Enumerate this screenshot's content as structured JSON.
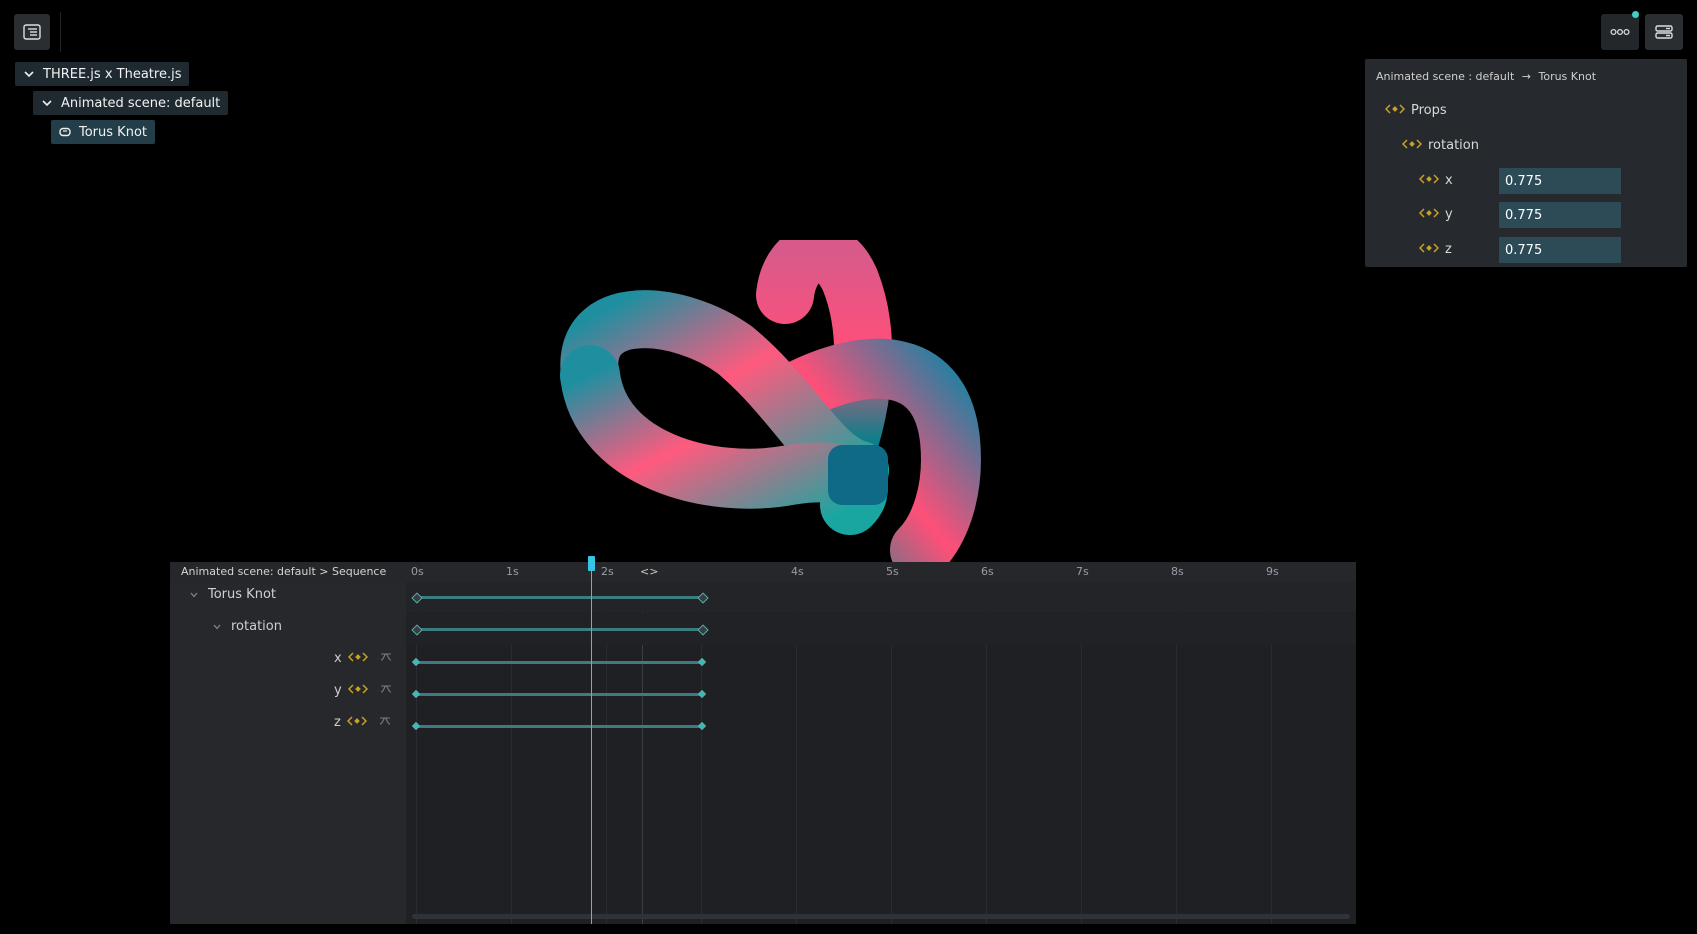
{
  "outline": {
    "items": [
      {
        "label": "THREE.js x Theatre.js"
      },
      {
        "label": "Animated scene: default"
      },
      {
        "label": "Torus Knot"
      }
    ]
  },
  "details": {
    "breadcrumb_sheet": "Animated scene : default",
    "breadcrumb_arrow": "→",
    "breadcrumb_object": "Torus Knot",
    "props_label": "Props",
    "rotation_label": "rotation",
    "fields": [
      {
        "label": "x",
        "value": "0.775"
      },
      {
        "label": "y",
        "value": "0.775"
      },
      {
        "label": "z",
        "value": "0.775"
      }
    ]
  },
  "sequence": {
    "breadcrumb": "Animated scene: default > Sequence",
    "ticks": [
      "0s",
      "1s",
      "2s",
      "4s",
      "5s",
      "6s",
      "7s",
      "8s",
      "9s"
    ],
    "range_end_icon": "<>",
    "rows": {
      "object": "Torus Knot",
      "prop": "rotation",
      "x": "x",
      "y": "y",
      "z": "z"
    },
    "playhead_position_s": 1.9,
    "range_end_s": 3
  },
  "colors": {
    "accent": "#35c6e6",
    "keyframe": "#4fb1b0",
    "input_bg": "#2c4b57",
    "icon_yellow": "#c9a227",
    "notification": "#3fd0c5"
  },
  "icons": {
    "outline_toggle": "outline-list-icon",
    "more": "ellipsis-icon",
    "details_toggle": "details-panel-icon",
    "sequence_toggle": "sequence-prop-icon",
    "graph": "graph-editor-icon",
    "object": "object-icon",
    "chevron": "chevron-down-icon"
  }
}
